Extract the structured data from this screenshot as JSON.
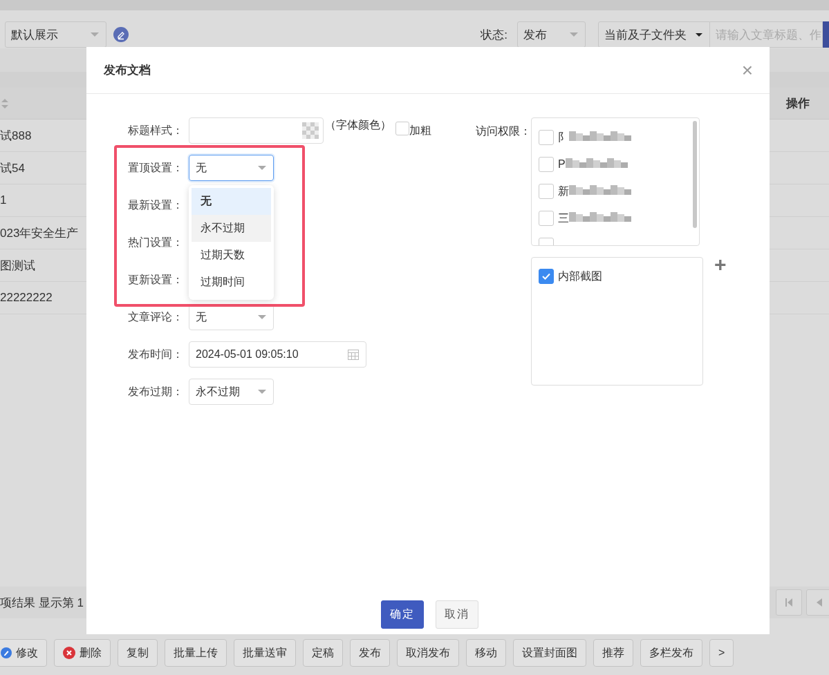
{
  "top_bar": {
    "view_select": "默认展示",
    "status_label": "状态:",
    "status_select": "发布",
    "folder_select": "当前及子文件夹",
    "search": {
      "placeholder": "请输入文章标题、作"
    }
  },
  "table": {
    "header": "操作",
    "rows": [
      {
        "column_1": "试888"
      },
      {
        "column_1": "试54"
      },
      {
        "column_1": "1"
      },
      {
        "column_1": "023年安全生产"
      },
      {
        "column_1": "图测试"
      },
      {
        "column_1": "22222222"
      }
    ]
  },
  "pager": {
    "summary": "项结果 显示第 1"
  },
  "toolbar": [
    {
      "label": "修改",
      "kind": "edit"
    },
    {
      "label": "删除",
      "kind": "delete"
    },
    {
      "label": "复制",
      "kind": "plain"
    },
    {
      "label": "批量上传",
      "kind": "plain"
    },
    {
      "label": "批量送审",
      "kind": "plain"
    },
    {
      "label": "定稿",
      "kind": "plain"
    },
    {
      "label": "发布",
      "kind": "plain"
    },
    {
      "label": "取消发布",
      "kind": "plain"
    },
    {
      "label": "移动",
      "kind": "plain"
    },
    {
      "label": "设置封面图",
      "kind": "plain"
    },
    {
      "label": "推荐",
      "kind": "plain"
    },
    {
      "label": "多栏发布",
      "kind": "plain"
    },
    {
      "label": ">",
      "kind": "plain"
    }
  ],
  "dialog": {
    "title": "发布文档",
    "close": "×",
    "form": [
      {
        "label": "标题样式：",
        "kind": "color",
        "note": "（字体颜色）",
        "bold_label": "加粗",
        "bold_checked": false
      },
      {
        "label": "置顶设置：",
        "kind": "select",
        "value": "无",
        "focused": true
      },
      {
        "label": "最新设置：",
        "kind": "hidden"
      },
      {
        "label": "热门设置：",
        "kind": "hidden"
      },
      {
        "label": "更新设置：",
        "kind": "hidden"
      },
      {
        "label": "文章评论：",
        "kind": "select",
        "value": "无",
        "focused": false
      },
      {
        "label": "发布时间：",
        "kind": "date",
        "value": "2024-05-01 09:05:10"
      },
      {
        "label": "发布过期：",
        "kind": "select",
        "value": "永不过期",
        "focused": false
      }
    ],
    "dropdown": [
      {
        "label": "无",
        "selected": true,
        "highlighted": false
      },
      {
        "label": "永不过期",
        "selected": false,
        "highlighted": true
      },
      {
        "label": "过期天数",
        "selected": false,
        "highlighted": false
      },
      {
        "label": "过期时间",
        "selected": false,
        "highlighted": false
      }
    ],
    "access": {
      "label": "访问权限：",
      "items": [
        {
          "label": "阝",
          "checked": false,
          "blurred": true
        },
        {
          "label": "P",
          "checked": false,
          "blurred": true
        },
        {
          "label": "新",
          "checked": false,
          "blurred": true
        },
        {
          "label": "三",
          "checked": false,
          "blurred": true
        },
        {
          "checked": false,
          "blurred": false
        }
      ]
    },
    "selected_groups": [
      {
        "label": "内部截图",
        "checked": true
      }
    ],
    "add": "+",
    "buttons": [
      {
        "label": "确定",
        "primary": true
      },
      {
        "label": "取消",
        "primary": false
      }
    ]
  }
}
